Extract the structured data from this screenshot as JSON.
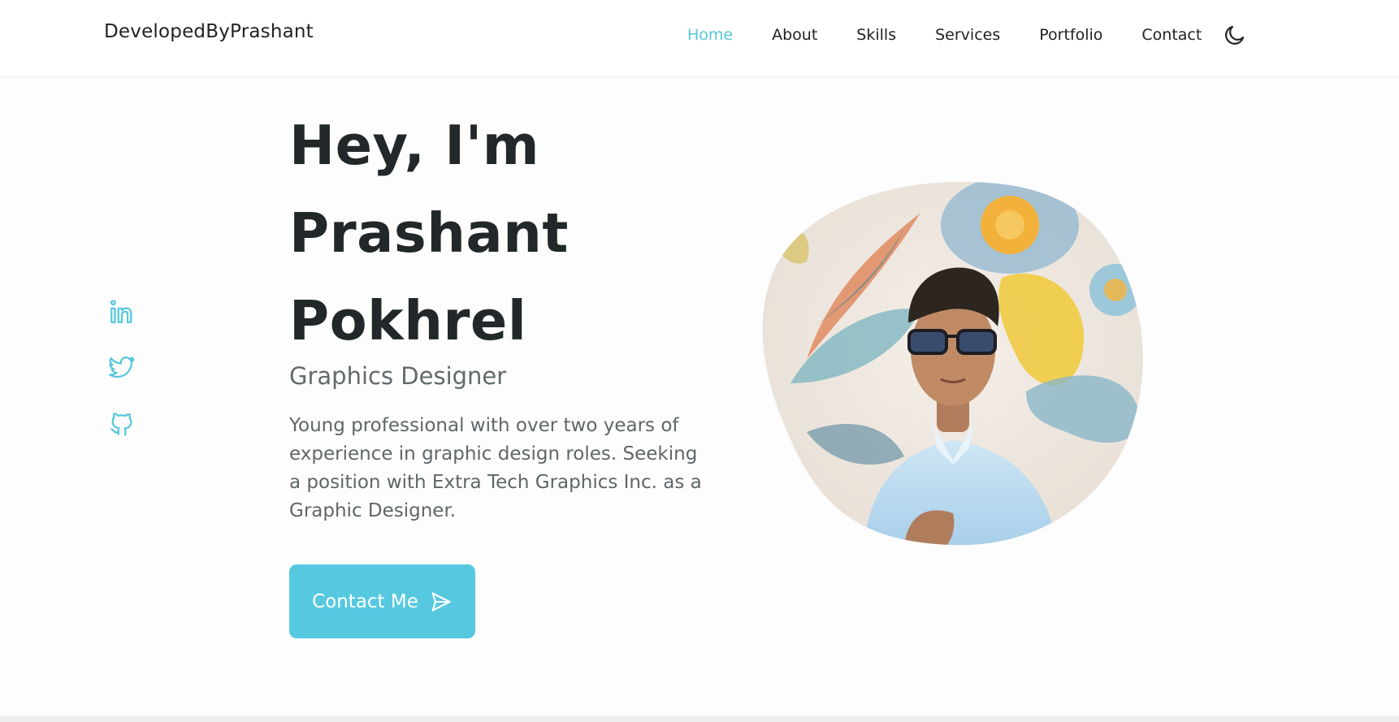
{
  "header": {
    "brand": "DevelopedByPrashant",
    "nav": [
      {
        "label": "Home",
        "active": true
      },
      {
        "label": "About",
        "active": false
      },
      {
        "label": "Skills",
        "active": false
      },
      {
        "label": "Services",
        "active": false
      },
      {
        "label": "Portfolio",
        "active": false
      },
      {
        "label": "Contact",
        "active": false
      }
    ],
    "theme_toggle_icon": "moon-icon"
  },
  "social": [
    {
      "icon": "linkedin-icon"
    },
    {
      "icon": "twitter-icon"
    },
    {
      "icon": "github-icon"
    }
  ],
  "hero": {
    "title_lines": [
      "Hey, I'm",
      "Prashant",
      "Pokhrel"
    ],
    "subtitle": "Graphics Designer",
    "description": "Young professional with over two years of experience in graphic design roles. Seeking a position with Extra Tech Graphics Inc. as a Graphic Designer.",
    "cta_label": "Contact Me",
    "cta_icon": "send-icon"
  },
  "colors": {
    "accent": "#56c9e0",
    "text_dark": "#222829",
    "text_muted": "#5f6668"
  }
}
